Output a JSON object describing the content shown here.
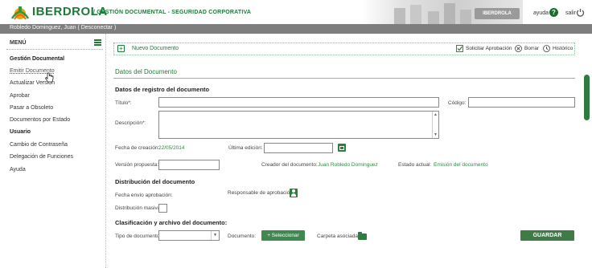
{
  "header": {
    "brand": "IBERDROLA",
    "subtitle": "/ GESTIÓN DOCUMENTAL - SEGURIDAD CORPORATIVA",
    "banner_sign": "IBERDROLA",
    "help_label": "ayuda",
    "help_icon_glyph": "?",
    "logout_label": "salir",
    "brand_color": "#1f7a3a"
  },
  "userbar": {
    "text": "Robledo Dominguez, Juan ( Desconectar )"
  },
  "sidebar": {
    "title": "MENÚ",
    "items": [
      {
        "label": "Gestión Documental",
        "type": "header"
      },
      {
        "label": "Emitir Documento",
        "type": "link",
        "active": true
      },
      {
        "label": "Actualizar Versión",
        "type": "link"
      },
      {
        "label": "Aprobar",
        "type": "link"
      },
      {
        "label": "Pasar a Obsoleto",
        "type": "link"
      },
      {
        "label": "Documentos por Estado",
        "type": "link"
      },
      {
        "label": "Usuario",
        "type": "header"
      },
      {
        "label": "Cambio de Contraseña",
        "type": "link"
      },
      {
        "label": "Delegación de Funciones",
        "type": "link"
      },
      {
        "label": "Ayuda",
        "type": "link"
      }
    ]
  },
  "toolbar": {
    "new_glyph": "+",
    "new_label": "Nuevo Documento",
    "request_approval": "Solicitar Aprobación",
    "delete": "Borrar",
    "history": "Histórico"
  },
  "form": {
    "section_title": "Datos del Documento",
    "registration_title": "Datos de registro del documento",
    "title_label": "Título*:",
    "title_value": "",
    "code_label": "Código:",
    "code_value": "",
    "description_label": "Descripción*:",
    "description_value": "",
    "created_label": "Fecha de creación:",
    "created_value": "22/05/2014",
    "last_edit_label": "Última edición:",
    "last_edit_value": "",
    "proposed_version_label": "Versión propuesta:",
    "proposed_version_value": "",
    "creator_label": "Creador del documento:",
    "creator_value": "Juan Robledo Dominguez",
    "status_label": "Estado actual:",
    "status_value": "Emisión del documento",
    "distribution_title": "Distribución del documento",
    "send_date_label": "Fecha envío aprobación:",
    "approver_label": "Responsable de aprobación:",
    "mass_distribution_label": "Distribución masiva:",
    "classification_title": "Clasificación y archivo del documento:",
    "doc_type_label": "Tipo de documento:",
    "doc_type_value": "",
    "document_label": "Documento:",
    "select_button": "+ Seleccionar",
    "folder_label": "Carpeta asociada:",
    "save_button": "GUARDAR",
    "scroll_up_glyph": "▲",
    "scroll_down_glyph": "▼",
    "select_arrow_glyph": "▼"
  }
}
